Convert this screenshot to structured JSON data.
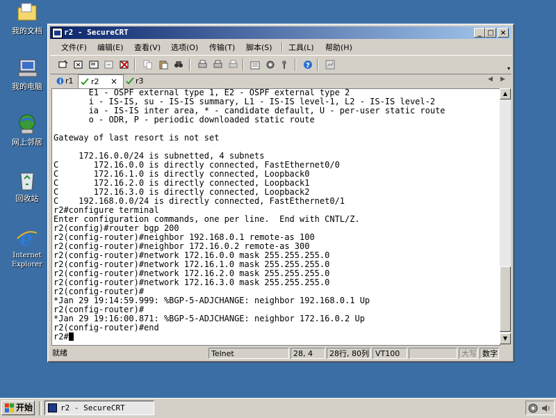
{
  "desktop": {
    "icons": [
      {
        "label": "我的文档",
        "icon": "my-documents-icon"
      },
      {
        "label": "我的电脑",
        "icon": "my-computer-icon"
      },
      {
        "label": "网上邻居",
        "icon": "network-places-icon"
      },
      {
        "label": "回收站",
        "icon": "recycle-bin-icon"
      },
      {
        "label": "Internet Explorer",
        "icon": "internet-explorer-icon"
      }
    ]
  },
  "window": {
    "title": "r2 - SecureCRT",
    "buttons": {
      "minimize": "_",
      "maximize": "□",
      "close": "×"
    }
  },
  "menu": [
    "文件(F)",
    "编辑(E)",
    "查看(V)",
    "选项(O)",
    "传输(T)",
    "脚本(S)",
    "工具(L)",
    "帮助(H)"
  ],
  "toolbar": {
    "icons": [
      "connect-icon",
      "quick-connect-icon",
      "connect-tab-icon",
      "reconnect-icon",
      "disconnect-icon",
      "copy-icon",
      "paste-icon",
      "find-icon",
      "print-icon",
      "print-selection-icon",
      "print-setup-icon",
      "session-options-icon",
      "global-options-icon",
      "keymap-icon",
      "help-icon",
      "log-icon"
    ]
  },
  "tabs": [
    {
      "label": "r1",
      "status": "info"
    },
    {
      "label": "r2",
      "status": "connected",
      "close": "×"
    },
    {
      "label": "r3",
      "status": "connected"
    }
  ],
  "terminal": {
    "lines": [
      "       E1 - OSPF external type 1, E2 - OSPF external type 2",
      "       i - IS-IS, su - IS-IS summary, L1 - IS-IS level-1, L2 - IS-IS level-2",
      "       ia - IS-IS inter area, * - candidate default, U - per-user static route",
      "       o - ODR, P - periodic downloaded static route",
      "",
      "Gateway of last resort is not set",
      "",
      "     172.16.0.0/24 is subnetted, 4 subnets",
      "C       172.16.0.0 is directly connected, FastEthernet0/0",
      "C       172.16.1.0 is directly connected, Loopback0",
      "C       172.16.2.0 is directly connected, Loopback1",
      "C       172.16.3.0 is directly connected, Loopback2",
      "C    192.168.0.0/24 is directly connected, FastEthernet0/1",
      "r2#configure terminal",
      "Enter configuration commands, one per line.  End with CNTL/Z.",
      "r2(config)#router bgp 200",
      "r2(config-router)#neighbor 192.168.0.1 remote-as 100",
      "r2(config-router)#neighbor 172.16.0.2 remote-as 300",
      "r2(config-router)#network 172.16.0.0 mask 255.255.255.0",
      "r2(config-router)#network 172.16.1.0 mask 255.255.255.0",
      "r2(config-router)#network 172.16.2.0 mask 255.255.255.0",
      "r2(config-router)#network 172.16.3.0 mask 255.255.255.0",
      "r2(config-router)#",
      "*Jan 29 19:14:59.999: %BGP-5-ADJCHANGE: neighbor 192.168.0.1 Up",
      "r2(config-router)#",
      "*Jan 29 19:16:00.871: %BGP-5-ADJCHANGE: neighbor 172.16.0.2 Up",
      "r2(config-router)#end"
    ],
    "prompt": "r2#"
  },
  "status": {
    "ready": "就绪",
    "protocol": "Telnet",
    "cursor": "28,  4",
    "size": "28行, 80列",
    "emulation": "VT100",
    "empty": "",
    "caps": "大写",
    "num": "数字"
  },
  "taskbar": {
    "start": "开始",
    "task": "r2 - SecureCRT"
  }
}
